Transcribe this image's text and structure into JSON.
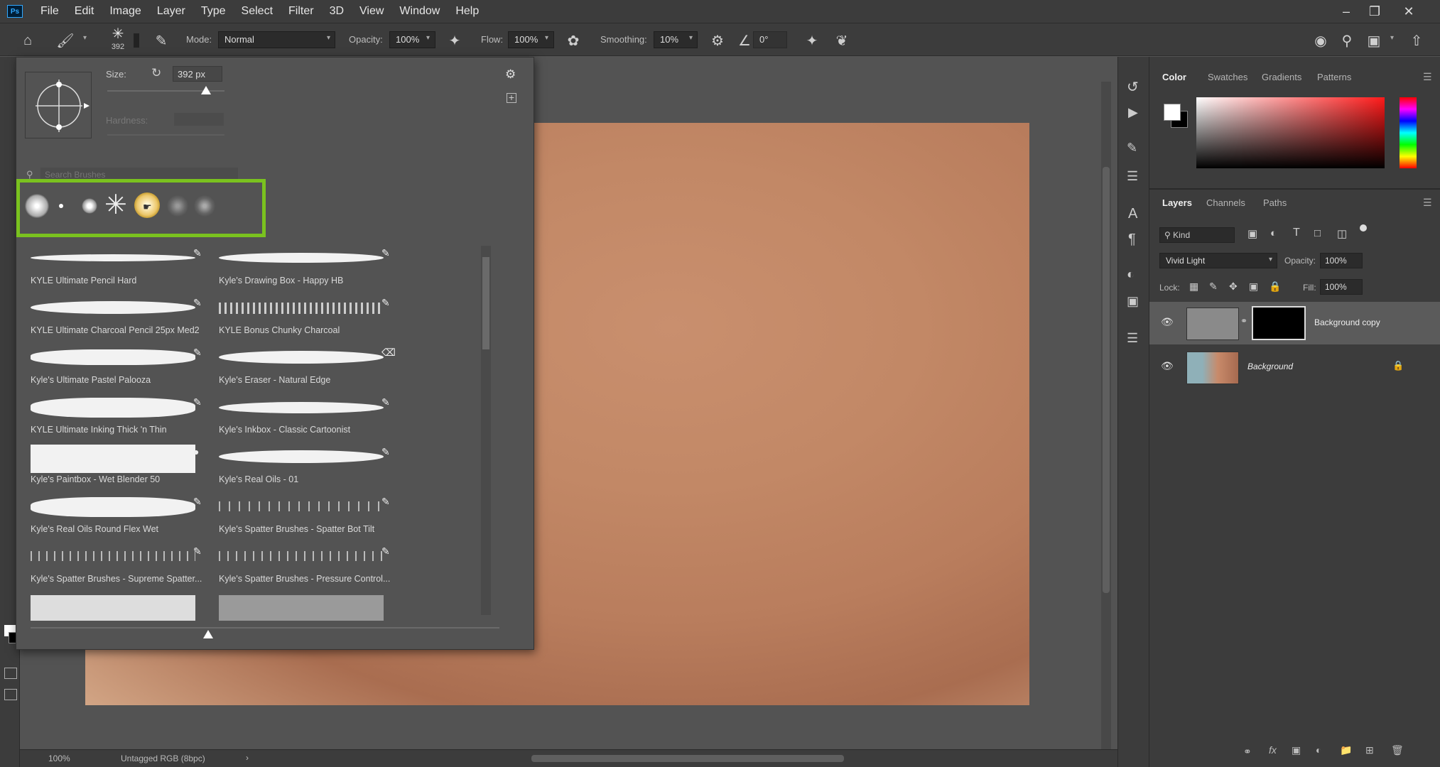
{
  "menubar": {
    "app_logo": "Ps",
    "items": [
      "File",
      "Edit",
      "Image",
      "Layer",
      "Type",
      "Select",
      "Filter",
      "3D",
      "View",
      "Window",
      "Help"
    ]
  },
  "options": {
    "brush_size_badge": "392",
    "mode_label": "Mode:",
    "mode_value": "Normal",
    "opacity_label": "Opacity:",
    "opacity_value": "100%",
    "flow_label": "Flow:",
    "flow_value": "100%",
    "smoothing_label": "Smoothing:",
    "smoothing_value": "10%",
    "angle_value": "0°"
  },
  "brush_panel": {
    "size_label": "Size:",
    "size_value": "392 px",
    "hardness_label": "Hardness:",
    "search_placeholder": "Search Brushes",
    "highlight_color": "#7ac21f",
    "brushes": [
      {
        "name": "KYLE Ultimate Pencil Hard"
      },
      {
        "name": "Kyle's Drawing Box - Happy HB"
      },
      {
        "name": "KYLE Ultimate Charcoal Pencil 25px Med2"
      },
      {
        "name": "KYLE Bonus Chunky Charcoal"
      },
      {
        "name": "Kyle's Ultimate Pastel Palooza"
      },
      {
        "name": "Kyle's Eraser - Natural Edge"
      },
      {
        "name": "KYLE Ultimate Inking Thick 'n Thin"
      },
      {
        "name": "Kyle's Inkbox - Classic Cartoonist"
      },
      {
        "name": "Kyle's Paintbox - Wet Blender 50"
      },
      {
        "name": "Kyle's Real Oils - 01"
      },
      {
        "name": "Kyle's Real Oils Round Flex Wet"
      },
      {
        "name": "Kyle's Spatter Brushes - Spatter Bot Tilt"
      },
      {
        "name": "Kyle's Spatter Brushes - Supreme Spatter..."
      },
      {
        "name": "Kyle's Spatter Brushes - Pressure Control..."
      }
    ]
  },
  "status": {
    "zoom": "100%",
    "doc_info": "Untagged RGB (8bpc)"
  },
  "color_panel": {
    "tabs": [
      "Color",
      "Swatches",
      "Gradients",
      "Patterns"
    ]
  },
  "layers_panel": {
    "tabs": [
      "Layers",
      "Channels",
      "Paths"
    ],
    "filter_label": "Kind",
    "blend_mode": "Vivid Light",
    "opacity_label": "Opacity:",
    "opacity_value": "100%",
    "lock_label": "Lock:",
    "fill_label": "Fill:",
    "fill_value": "100%",
    "layers": [
      {
        "name": "Background copy"
      },
      {
        "name": "Background"
      }
    ]
  }
}
